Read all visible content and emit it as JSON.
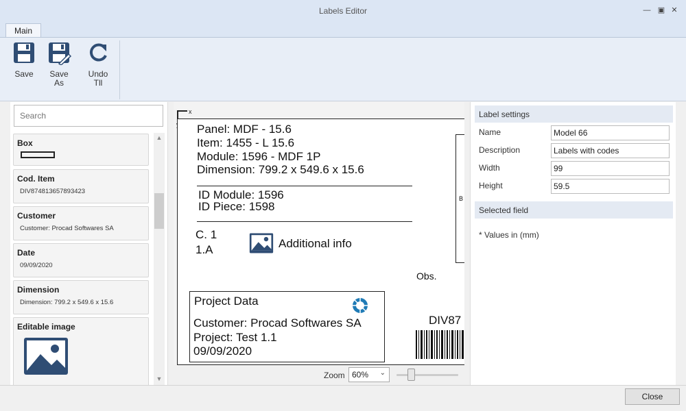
{
  "window": {
    "title": "Labels Editor"
  },
  "ribbon": {
    "tab_main": "Main",
    "save_label": "Save",
    "save_as_label": "Save As",
    "undo_label": "Undo",
    "undo_count": "Tll"
  },
  "left_panel": {
    "search_placeholder": "Search",
    "fields": [
      {
        "name": "Box",
        "value": ""
      },
      {
        "name": "Cod. Item",
        "value": "DIV874813657893423"
      },
      {
        "name": "Customer",
        "value": "Customer: Procad Softwares SA"
      },
      {
        "name": "Date",
        "value": "09/09/2020"
      },
      {
        "name": "Dimension",
        "value": "Dimension: 799.2 x 549.6 x 15.6"
      },
      {
        "name": "Editable image",
        "value": ""
      }
    ]
  },
  "canvas": {
    "axis_x": "x",
    "axis_y": "y",
    "panel": "Panel: MDF - 15.6",
    "item": "Item: 1455 - L 15.6",
    "module": "Module: 1596 - MDF 1P",
    "dimension": "Dimension: 799.2 x 549.6 x 15.6",
    "id_module": "ID Module: 1596",
    "id_piece": "ID Piece: 1598",
    "c1": "C. 1",
    "one_a": "1.A",
    "additional_info": "Additional info",
    "obs": "Obs.",
    "bracket_letter": "B",
    "project_title": "Project Data",
    "project_customer": "Customer: Procad Softwares SA",
    "project_name": "Project: Test 1.1",
    "project_date": "09/09/2020",
    "barcode_text": "DIV87"
  },
  "zoom": {
    "label": "Zoom",
    "value": "60%"
  },
  "right_panel": {
    "label_settings_title": "Label settings",
    "name_label": "Name",
    "name_value": "Model 66",
    "description_label": "Description",
    "description_value": "Labels with codes",
    "width_label": "Width",
    "width_value": "99",
    "height_label": "Height",
    "height_value": "59.5",
    "selected_field_title": "Selected field",
    "units_note": "* Values in (mm)"
  },
  "footer": {
    "close_label": "Close"
  },
  "colors": {
    "ribbon_bg": "#e8eef7",
    "titlebar_bg": "#dce6f4",
    "icon_blue": "#2f4d74",
    "logo_blue": "#1f7bb6"
  }
}
